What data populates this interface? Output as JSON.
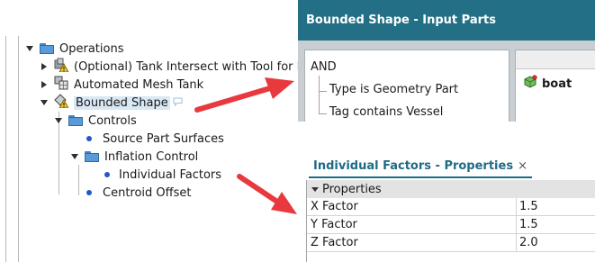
{
  "tree": {
    "items": [
      {
        "label": "Operations",
        "icon": "folder-icon",
        "expanded": true
      },
      {
        "label": "(Optional) Tank Intersect with Tool for F",
        "icon": "operation-warning-icon",
        "expanded": false
      },
      {
        "label": "Automated Mesh Tank",
        "icon": "mesh-operation-icon",
        "expanded": false
      },
      {
        "label": "Bounded Shape",
        "icon": "bounded-shape-warning-icon",
        "expanded": true,
        "selected": true
      },
      {
        "label": "Controls",
        "icon": "folder-icon",
        "expanded": true
      },
      {
        "label": "Source Part Surfaces",
        "icon": "dot-icon"
      },
      {
        "label": "Inflation Control",
        "icon": "folder-icon",
        "expanded": true
      },
      {
        "label": "Individual Factors",
        "icon": "dot-icon"
      },
      {
        "label": "Centroid Offset",
        "icon": "dot-icon"
      }
    ]
  },
  "input_parts": {
    "title": "Bounded Shape - Input Parts",
    "criteria": {
      "operator": "AND",
      "conditions": [
        "Type is Geometry Part",
        "Tag contains Vessel"
      ]
    },
    "parts": [
      {
        "label": "boat",
        "icon": "part-icon"
      }
    ]
  },
  "properties": {
    "tab_title": "Individual Factors - Properties",
    "close_glyph": "×",
    "group_label": "Properties",
    "rows": [
      {
        "key": "X Factor",
        "value": "1.5"
      },
      {
        "key": "Y Factor",
        "value": "1.5"
      },
      {
        "key": "Z Factor",
        "value": "2.0"
      }
    ]
  },
  "colors": {
    "header_teal": "#236f86",
    "arrow_red": "#e8393f",
    "selection": "#d9e8f5",
    "node_dot": "#2457c8",
    "folder_blue": "#5a9ad8"
  }
}
